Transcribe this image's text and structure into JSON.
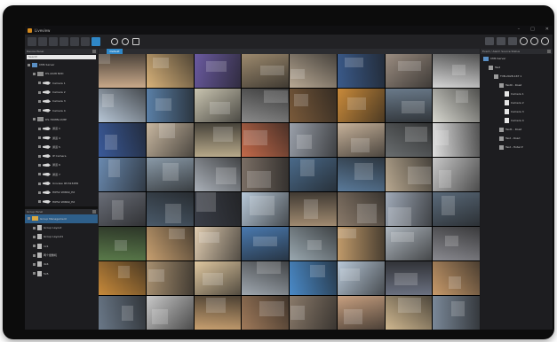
{
  "window": {
    "title": "Liveview",
    "controls": [
      "–",
      "□",
      "✕"
    ]
  },
  "toolbar": {
    "layout_buttons": [
      "layout-1",
      "layout-4",
      "layout-9",
      "layout-16",
      "layout-25",
      "layout-36",
      "layout-64"
    ],
    "active_layout": 6,
    "tool_icons": [
      "settings-icon",
      "log-icon",
      "lock-icon"
    ],
    "right_buttons": [
      "screen-1",
      "screen-2",
      "screen-3"
    ],
    "right_icons": [
      "clock-icon",
      "alert-icon",
      "user-icon"
    ]
  },
  "left_panel": {
    "device_header": "Device Panel",
    "search_placeholder": "Search",
    "tree": [
      {
        "label": "CMS Server",
        "type": "server",
        "indent": 0
      },
      {
        "label": "DS-4228 NVD",
        "type": "dvr",
        "indent": 1
      },
      {
        "label": "Camera 1",
        "type": "camera",
        "indent": 2
      },
      {
        "label": "Camera 2",
        "type": "camera",
        "indent": 2
      },
      {
        "label": "Camera 3",
        "type": "camera",
        "indent": 2
      },
      {
        "label": "Camera 4",
        "type": "camera",
        "indent": 2
      },
      {
        "label": "DS-7608N-I2/8P",
        "type": "dvr",
        "indent": 1
      },
      {
        "label": "通道 1",
        "type": "camera",
        "indent": 2
      },
      {
        "label": "通道 4",
        "type": "camera",
        "indent": 2
      },
      {
        "label": "通道 5",
        "type": "camera",
        "indent": 2
      },
      {
        "label": "IP Camera",
        "type": "camera",
        "indent": 2
      },
      {
        "label": "通道 6",
        "type": "camera",
        "indent": 2
      },
      {
        "label": "通道 7",
        "type": "camera",
        "indent": 2
      },
      {
        "label": "Uniview IPC3232ER",
        "type": "camera",
        "indent": 2
      },
      {
        "label": "HIP52 WINS0_Hd",
        "type": "camera",
        "indent": 2
      },
      {
        "label": "HIP52 WINS0_Hd",
        "type": "camera",
        "indent": 2
      }
    ],
    "group_header": "Group Panel",
    "groups": [
      {
        "label": "Group Management",
        "type": "group",
        "indent": 0,
        "selected": true
      },
      {
        "label": "Group Layout",
        "type": "layout",
        "indent": 1
      },
      {
        "label": "Group Layout1",
        "type": "layout",
        "indent": 1
      },
      {
        "label": "1x1",
        "type": "layout",
        "indent": 1
      },
      {
        "label": "两个摄像机",
        "type": "layout",
        "indent": 1
      },
      {
        "label": "4x4",
        "type": "layout",
        "indent": 1
      },
      {
        "label": "5x5",
        "type": "layout",
        "indent": 1
      }
    ]
  },
  "view_tab": {
    "label": "Default"
  },
  "right_panel": {
    "header": "Event / Alarm Source Status",
    "tree": [
      {
        "label": "CMS Server",
        "type": "server",
        "indent": 0
      },
      {
        "label": "Test",
        "type": "small",
        "indent": 1
      },
      {
        "label": "TVB-2928-16T 1",
        "type": "small",
        "indent": 2
      },
      {
        "label": "Test0 - Road",
        "type": "small",
        "indent": 3
      },
      {
        "label": "Camera 1",
        "type": "ch",
        "indent": 4
      },
      {
        "label": "Camera 2",
        "type": "ch",
        "indent": 4
      },
      {
        "label": "Camera 3",
        "type": "ch",
        "indent": 4
      },
      {
        "label": "Camera 4",
        "type": "ch",
        "indent": 4
      },
      {
        "label": "Test1 - Road",
        "type": "small",
        "indent": 3
      },
      {
        "label": "Test - Road",
        "type": "small",
        "indent": 3
      },
      {
        "label": "Test - Hotel P",
        "type": "small",
        "indent": 3
      }
    ]
  },
  "video_tiles": [
    [
      "#c9a98a",
      "#d9b37a",
      "#6a5aa0",
      "#9d8a6e",
      "#b9a994",
      "#3a5a8a",
      "#9a8c80",
      "#d6d6d6"
    ],
    [
      "#b7c6d6",
      "#5a7fa6",
      "#c9c4b0",
      "#8a8a8a",
      "#7a5a3a",
      "#c98a3a",
      "#6a7a8a",
      "#d8d8d0"
    ],
    [
      "#3a5a9a",
      "#c8b7a0",
      "#b7a98a",
      "#c46a4a",
      "#9aa0aa",
      "#c7b29a",
      "#6a6e70",
      "#e0e0e0"
    ],
    [
      "#6a8ab0",
      "#8a9aa8",
      "#aab0b8",
      "#7a6e64",
      "#4a6a8a",
      "#5a7a9a",
      "#b8a890",
      "#c8c8c8"
    ],
    [
      "#6a6e78",
      "#4a5a6a",
      "#3a3e48",
      "#b7c8d8",
      "#a08a70",
      "#8a7a6a",
      "#a0aab8",
      "#5a6a7a"
    ],
    [
      "#5a7a4a",
      "#c8a070",
      "#e0ccb0",
      "#4a7ab0",
      "#9aa8b0",
      "#c09a6a",
      "#b0b8c0",
      "#8a8a90"
    ],
    [
      "#c88a3a",
      "#a89070",
      "#e0c8a0",
      "#a0a8b0",
      "#4a8ac8",
      "#b8c8d8",
      "#6a7080",
      "#c89a6a"
    ],
    [
      "#6a7888",
      "#c8c8c8",
      "#c8a070",
      "#a07a5a",
      "#8a7a6a",
      "#c8a080",
      "#d0b890",
      "#7a8898"
    ]
  ]
}
